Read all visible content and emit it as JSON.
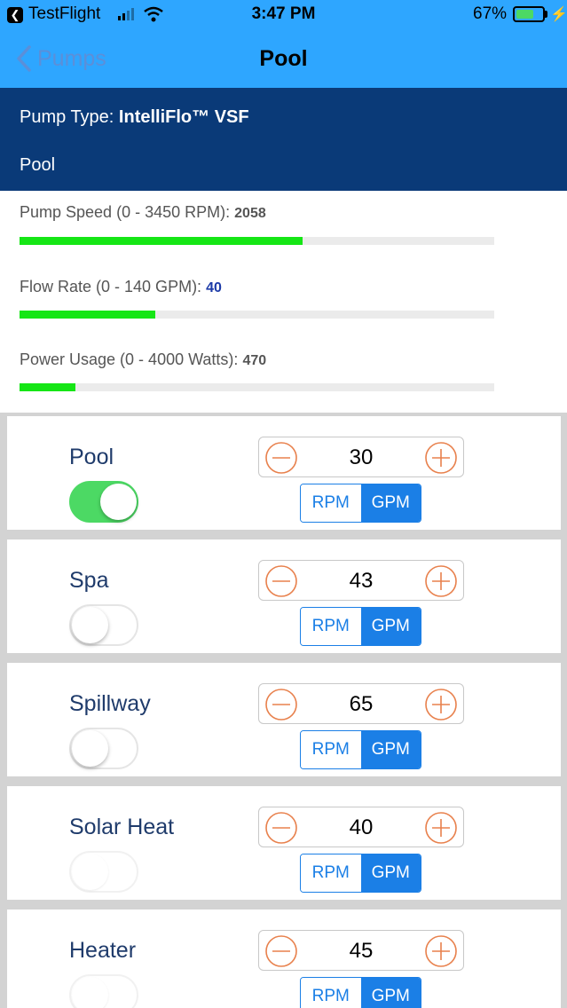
{
  "status_bar": {
    "carrier": "TestFlight",
    "time": "3:47 PM",
    "battery_percent": "67%",
    "battery_level": 0.67,
    "back_icon": "back-to-app-icon"
  },
  "nav": {
    "back_label": "Pumps",
    "title": "Pool"
  },
  "header": {
    "pump_type_label": "Pump Type:",
    "pump_type_value": "IntelliFlo™ VSF",
    "pump_name": "Pool"
  },
  "stats": [
    {
      "label": "Pump Speed (0 - 3450 RPM):",
      "value": "2058",
      "fraction": 0.597,
      "value_color": "#555555"
    },
    {
      "label": "Flow Rate (0 - 140 GPM):",
      "value": "40",
      "fraction": 0.286,
      "value_color": "#1d3ba8"
    },
    {
      "label": "Power Usage (0 - 4000 Watts):",
      "value": "470",
      "fraction": 0.118,
      "value_color": "#555555"
    }
  ],
  "circuits": [
    {
      "name": "Pool",
      "on": true,
      "value": "30",
      "units": [
        "RPM",
        "GPM"
      ],
      "selected_unit": "GPM"
    },
    {
      "name": "Spa",
      "on": false,
      "value": "43",
      "units": [
        "RPM",
        "GPM"
      ],
      "selected_unit": "GPM"
    },
    {
      "name": "Spillway",
      "on": false,
      "value": "65",
      "units": [
        "RPM",
        "GPM"
      ],
      "selected_unit": "GPM"
    },
    {
      "name": "Solar Heat",
      "on": false,
      "dim": true,
      "value": "40",
      "units": [
        "RPM",
        "GPM"
      ],
      "selected_unit": "GPM"
    },
    {
      "name": "Heater",
      "on": false,
      "dim": true,
      "value": "45",
      "units": [
        "RPM",
        "GPM"
      ],
      "selected_unit": "GPM"
    }
  ],
  "colors": {
    "nav_bar": "#2ea6ff",
    "header": "#0a3a78",
    "progress": "#15e615",
    "stepper_icon": "#e8814d",
    "segment_accent": "#1b7fe6",
    "toggle_on": "#4cd964"
  },
  "icons": {
    "minus": "minus-circle-icon",
    "plus": "plus-circle-icon",
    "back": "chevron-left-icon"
  }
}
